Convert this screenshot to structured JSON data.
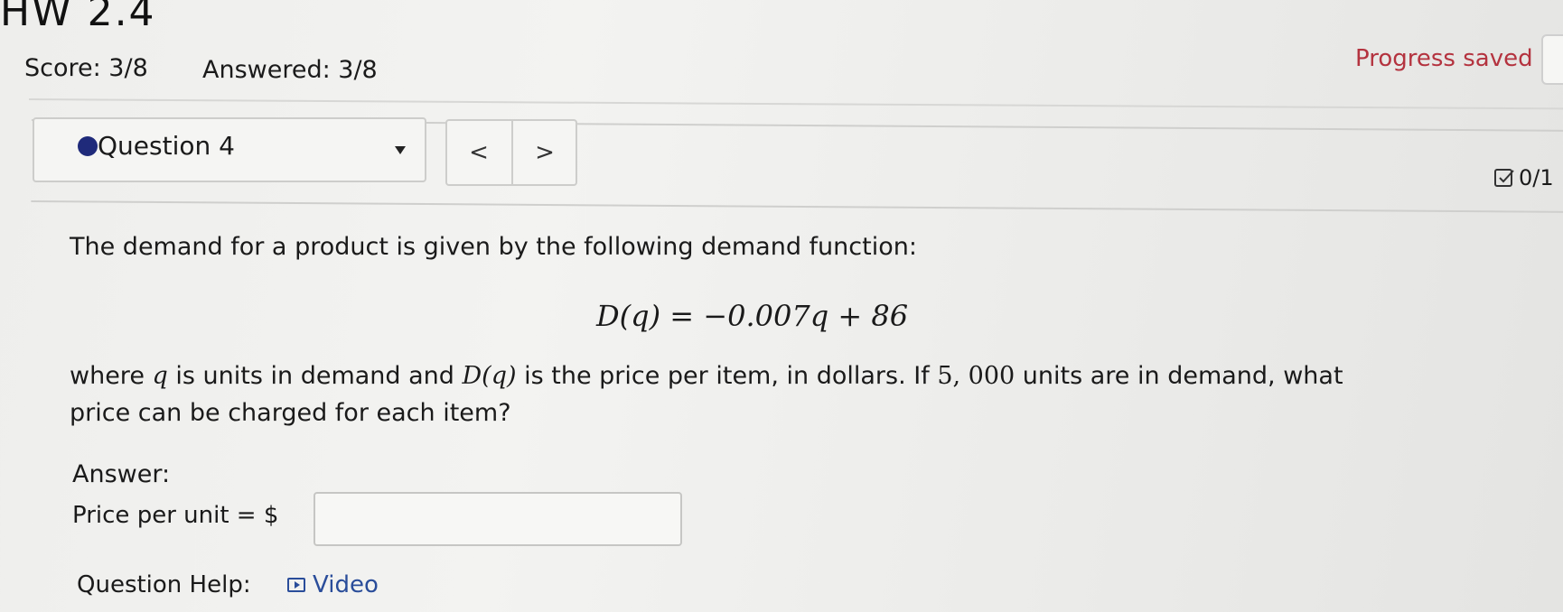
{
  "header": {
    "title": "HW 2.4",
    "score": "Score: 3/8",
    "answered": "Answered: 3/8",
    "progress_status": "Progress saved"
  },
  "question_nav": {
    "current_label": "Question 4",
    "prev_symbol": "<",
    "next_symbol": ">",
    "points": "0/1"
  },
  "question": {
    "prompt": "The demand for a product is given by the following demand function:",
    "formula": "D(q) = −0.007q + 86",
    "body_line1_part1": "where ",
    "var_q": "q",
    "body_line1_part2": " is units in demand and ",
    "var_Dq": "D(q)",
    "body_line1_part3": " is the price per item, in dollars. If ",
    "quantity": "5, 000",
    "body_line1_part4": " units are in demand, what",
    "body_line2": "price can be charged for each item?"
  },
  "answer": {
    "heading": "Answer:",
    "price_label": "Price per unit = $",
    "price_value": ""
  },
  "help": {
    "label": "Question Help:",
    "video_label": "Video"
  },
  "colors": {
    "progress_saved": "#b4333f",
    "question_dot": "#1f2a7a",
    "link": "#2a4d9a"
  }
}
